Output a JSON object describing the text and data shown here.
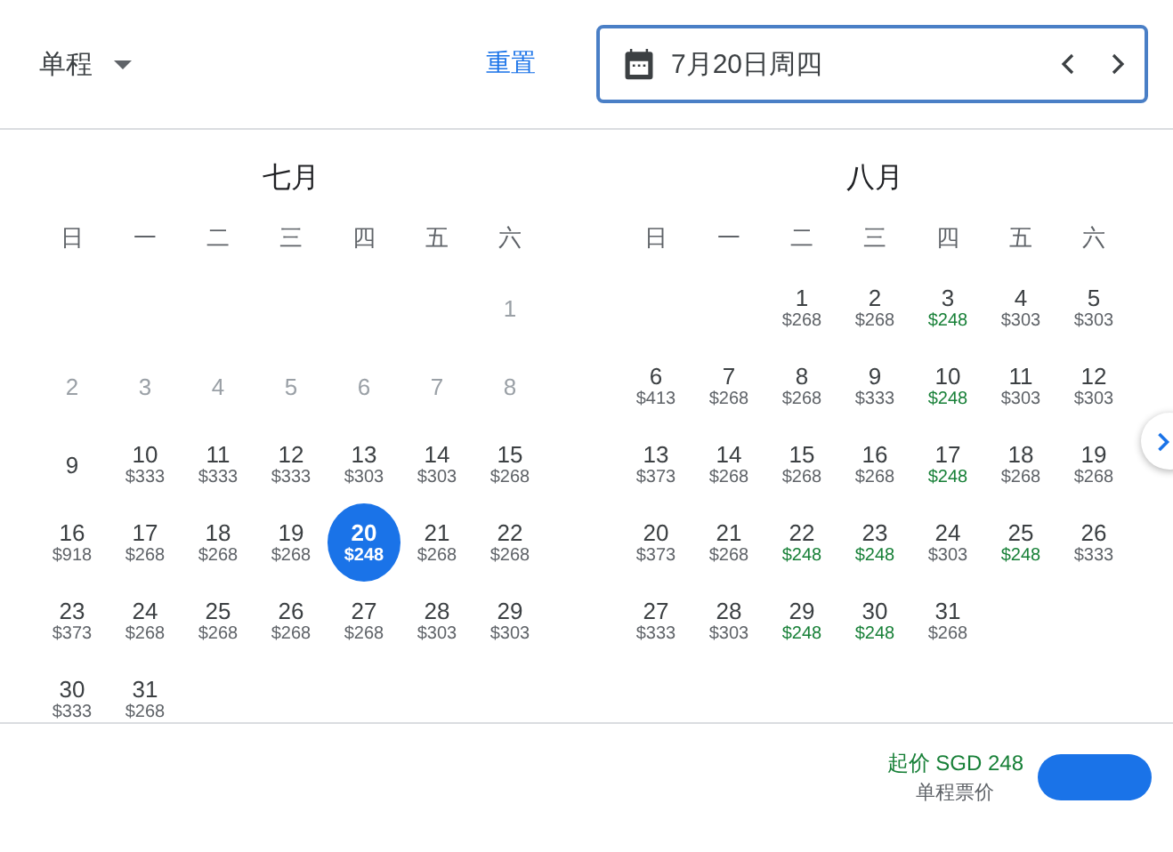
{
  "trip_type": {
    "label": "单程"
  },
  "reset_link": "重置",
  "date_field": {
    "value": "7月20日周四"
  },
  "months": [
    {
      "title": "七月",
      "weekdays": [
        "日",
        "一",
        "二",
        "三",
        "四",
        "五",
        "六"
      ],
      "weeks": [
        [
          {
            "kind": "blank"
          },
          {
            "kind": "blank"
          },
          {
            "kind": "blank"
          },
          {
            "kind": "blank"
          },
          {
            "kind": "blank"
          },
          {
            "kind": "blank"
          },
          {
            "kind": "disabled",
            "day": "1"
          }
        ],
        [
          {
            "kind": "disabled",
            "day": "2"
          },
          {
            "kind": "disabled",
            "day": "3"
          },
          {
            "kind": "disabled",
            "day": "4"
          },
          {
            "kind": "disabled",
            "day": "5"
          },
          {
            "kind": "disabled",
            "day": "6"
          },
          {
            "kind": "disabled",
            "day": "7"
          },
          {
            "kind": "disabled",
            "day": "8"
          }
        ],
        [
          {
            "kind": "day",
            "day": "9",
            "selected": false
          },
          {
            "kind": "day",
            "day": "10",
            "price": "$333",
            "lowest": false,
            "selected": false
          },
          {
            "kind": "day",
            "day": "11",
            "price": "$333",
            "lowest": false,
            "selected": false
          },
          {
            "kind": "day",
            "day": "12",
            "price": "$333",
            "lowest": false,
            "selected": false
          },
          {
            "kind": "day",
            "day": "13",
            "price": "$303",
            "lowest": false,
            "selected": false
          },
          {
            "kind": "day",
            "day": "14",
            "price": "$303",
            "lowest": false,
            "selected": false
          },
          {
            "kind": "day",
            "day": "15",
            "price": "$268",
            "lowest": false,
            "selected": false
          }
        ],
        [
          {
            "kind": "day",
            "day": "16",
            "price": "$918",
            "lowest": false,
            "selected": false
          },
          {
            "kind": "day",
            "day": "17",
            "price": "$268",
            "lowest": false,
            "selected": false
          },
          {
            "kind": "day",
            "day": "18",
            "price": "$268",
            "lowest": false,
            "selected": false
          },
          {
            "kind": "day",
            "day": "19",
            "price": "$268",
            "lowest": false,
            "selected": false
          },
          {
            "kind": "day",
            "day": "20",
            "price": "$248",
            "lowest": true,
            "selected": true
          },
          {
            "kind": "day",
            "day": "21",
            "price": "$268",
            "lowest": false,
            "selected": false
          },
          {
            "kind": "day",
            "day": "22",
            "price": "$268",
            "lowest": false,
            "selected": false
          }
        ],
        [
          {
            "kind": "day",
            "day": "23",
            "price": "$373",
            "lowest": false,
            "selected": false
          },
          {
            "kind": "day",
            "day": "24",
            "price": "$268",
            "lowest": false,
            "selected": false
          },
          {
            "kind": "day",
            "day": "25",
            "price": "$268",
            "lowest": false,
            "selected": false
          },
          {
            "kind": "day",
            "day": "26",
            "price": "$268",
            "lowest": false,
            "selected": false
          },
          {
            "kind": "day",
            "day": "27",
            "price": "$268",
            "lowest": false,
            "selected": false
          },
          {
            "kind": "day",
            "day": "28",
            "price": "$303",
            "lowest": false,
            "selected": false
          },
          {
            "kind": "day",
            "day": "29",
            "price": "$303",
            "lowest": false,
            "selected": false
          }
        ],
        [
          {
            "kind": "day",
            "day": "30",
            "price": "$333",
            "lowest": false,
            "selected": false
          },
          {
            "kind": "day",
            "day": "31",
            "price": "$268",
            "lowest": false,
            "selected": false
          }
        ]
      ]
    },
    {
      "title": "八月",
      "weekdays": [
        "日",
        "一",
        "二",
        "三",
        "四",
        "五",
        "六"
      ],
      "weeks": [
        [
          {
            "kind": "blank"
          },
          {
            "kind": "blank"
          },
          {
            "kind": "day",
            "day": "1",
            "price": "$268",
            "lowest": false,
            "selected": false
          },
          {
            "kind": "day",
            "day": "2",
            "price": "$268",
            "lowest": false,
            "selected": false
          },
          {
            "kind": "day",
            "day": "3",
            "price": "$248",
            "lowest": true,
            "selected": false
          },
          {
            "kind": "day",
            "day": "4",
            "price": "$303",
            "lowest": false,
            "selected": false
          },
          {
            "kind": "day",
            "day": "5",
            "price": "$303",
            "lowest": false,
            "selected": false
          }
        ],
        [
          {
            "kind": "day",
            "day": "6",
            "price": "$413",
            "lowest": false,
            "selected": false
          },
          {
            "kind": "day",
            "day": "7",
            "price": "$268",
            "lowest": false,
            "selected": false
          },
          {
            "kind": "day",
            "day": "8",
            "price": "$268",
            "lowest": false,
            "selected": false
          },
          {
            "kind": "day",
            "day": "9",
            "price": "$333",
            "lowest": false,
            "selected": false
          },
          {
            "kind": "day",
            "day": "10",
            "price": "$248",
            "lowest": true,
            "selected": false
          },
          {
            "kind": "day",
            "day": "11",
            "price": "$303",
            "lowest": false,
            "selected": false
          },
          {
            "kind": "day",
            "day": "12",
            "price": "$303",
            "lowest": false,
            "selected": false
          }
        ],
        [
          {
            "kind": "day",
            "day": "13",
            "price": "$373",
            "lowest": false,
            "selected": false
          },
          {
            "kind": "day",
            "day": "14",
            "price": "$268",
            "lowest": false,
            "selected": false
          },
          {
            "kind": "day",
            "day": "15",
            "price": "$268",
            "lowest": false,
            "selected": false
          },
          {
            "kind": "day",
            "day": "16",
            "price": "$268",
            "lowest": false,
            "selected": false
          },
          {
            "kind": "day",
            "day": "17",
            "price": "$248",
            "lowest": true,
            "selected": false
          },
          {
            "kind": "day",
            "day": "18",
            "price": "$268",
            "lowest": false,
            "selected": false
          },
          {
            "kind": "day",
            "day": "19",
            "price": "$268",
            "lowest": false,
            "selected": false
          }
        ],
        [
          {
            "kind": "day",
            "day": "20",
            "price": "$373",
            "lowest": false,
            "selected": false
          },
          {
            "kind": "day",
            "day": "21",
            "price": "$268",
            "lowest": false,
            "selected": false
          },
          {
            "kind": "day",
            "day": "22",
            "price": "$248",
            "lowest": true,
            "selected": false
          },
          {
            "kind": "day",
            "day": "23",
            "price": "$248",
            "lowest": true,
            "selected": false
          },
          {
            "kind": "day",
            "day": "24",
            "price": "$303",
            "lowest": false,
            "selected": false
          },
          {
            "kind": "day",
            "day": "25",
            "price": "$248",
            "lowest": true,
            "selected": false
          },
          {
            "kind": "day",
            "day": "26",
            "price": "$333",
            "lowest": false,
            "selected": false
          }
        ],
        [
          {
            "kind": "day",
            "day": "27",
            "price": "$333",
            "lowest": false,
            "selected": false
          },
          {
            "kind": "day",
            "day": "28",
            "price": "$303",
            "lowest": false,
            "selected": false
          },
          {
            "kind": "day",
            "day": "29",
            "price": "$248",
            "lowest": true,
            "selected": false
          },
          {
            "kind": "day",
            "day": "30",
            "price": "$248",
            "lowest": true,
            "selected": false
          },
          {
            "kind": "day",
            "day": "31",
            "price": "$268",
            "lowest": false,
            "selected": false
          }
        ]
      ]
    }
  ],
  "footer": {
    "price": "起价 SGD 248",
    "note": "单程票价"
  }
}
